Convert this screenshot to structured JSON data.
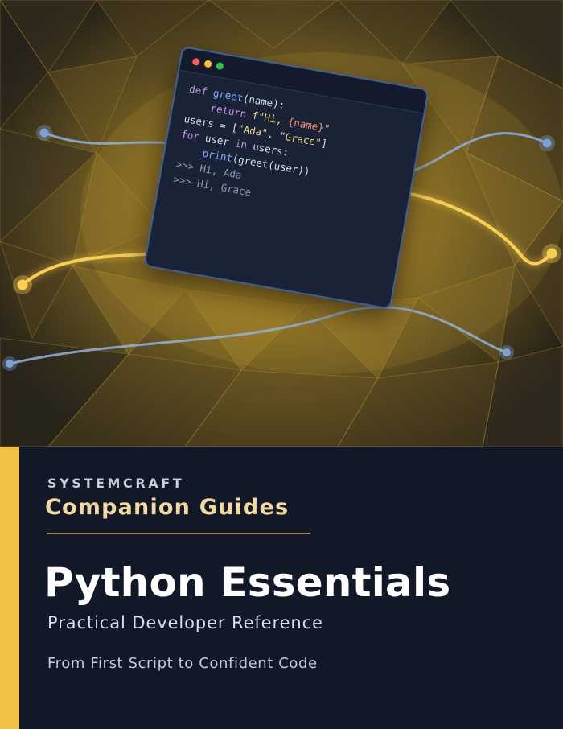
{
  "artwork": {
    "code_window": {
      "buttons": [
        "close",
        "minimize",
        "maximize"
      ],
      "lines": [
        [
          {
            "t": "def ",
            "c": "kw"
          },
          {
            "t": "greet",
            "c": "fn"
          },
          {
            "t": "(name):",
            "c": "plain"
          }
        ],
        [
          {
            "t": "    return ",
            "c": "kw"
          },
          {
            "t": "f\"Hi, ",
            "c": "str"
          },
          {
            "t": "{name}",
            "c": "num"
          },
          {
            "t": "\"",
            "c": "str"
          }
        ],
        [
          {
            "t": "users = [",
            "c": "plain"
          },
          {
            "t": "\"Ada\"",
            "c": "str"
          },
          {
            "t": ", ",
            "c": "plain"
          },
          {
            "t": "\"Grace\"",
            "c": "str"
          },
          {
            "t": "]",
            "c": "plain"
          }
        ],
        [
          {
            "t": "for ",
            "c": "kw"
          },
          {
            "t": "user ",
            "c": "plain"
          },
          {
            "t": "in ",
            "c": "kw"
          },
          {
            "t": "users:",
            "c": "plain"
          }
        ],
        [
          {
            "t": "    print",
            "c": "fn"
          },
          {
            "t": "(greet(user))",
            "c": "plain"
          }
        ],
        [
          {
            "t": ">>> Hi, Ada",
            "c": "out"
          }
        ],
        [
          {
            "t": ">>> Hi, Grace",
            "c": "out"
          }
        ]
      ]
    }
  },
  "cover": {
    "brand": "SYSTEMCRAFT",
    "series": "Companion Guides",
    "title": "Python Essentials",
    "subtitle": "Practical Developer Reference",
    "tagline": "From First Script to Confident Code"
  },
  "colors": {
    "background": "#111827",
    "accent": "#f2c043",
    "series_text": "#f3d9a0",
    "title_text": "#ffffff",
    "artwork_gold": "#d9a82a",
    "line_blue": "#8fb3df"
  }
}
